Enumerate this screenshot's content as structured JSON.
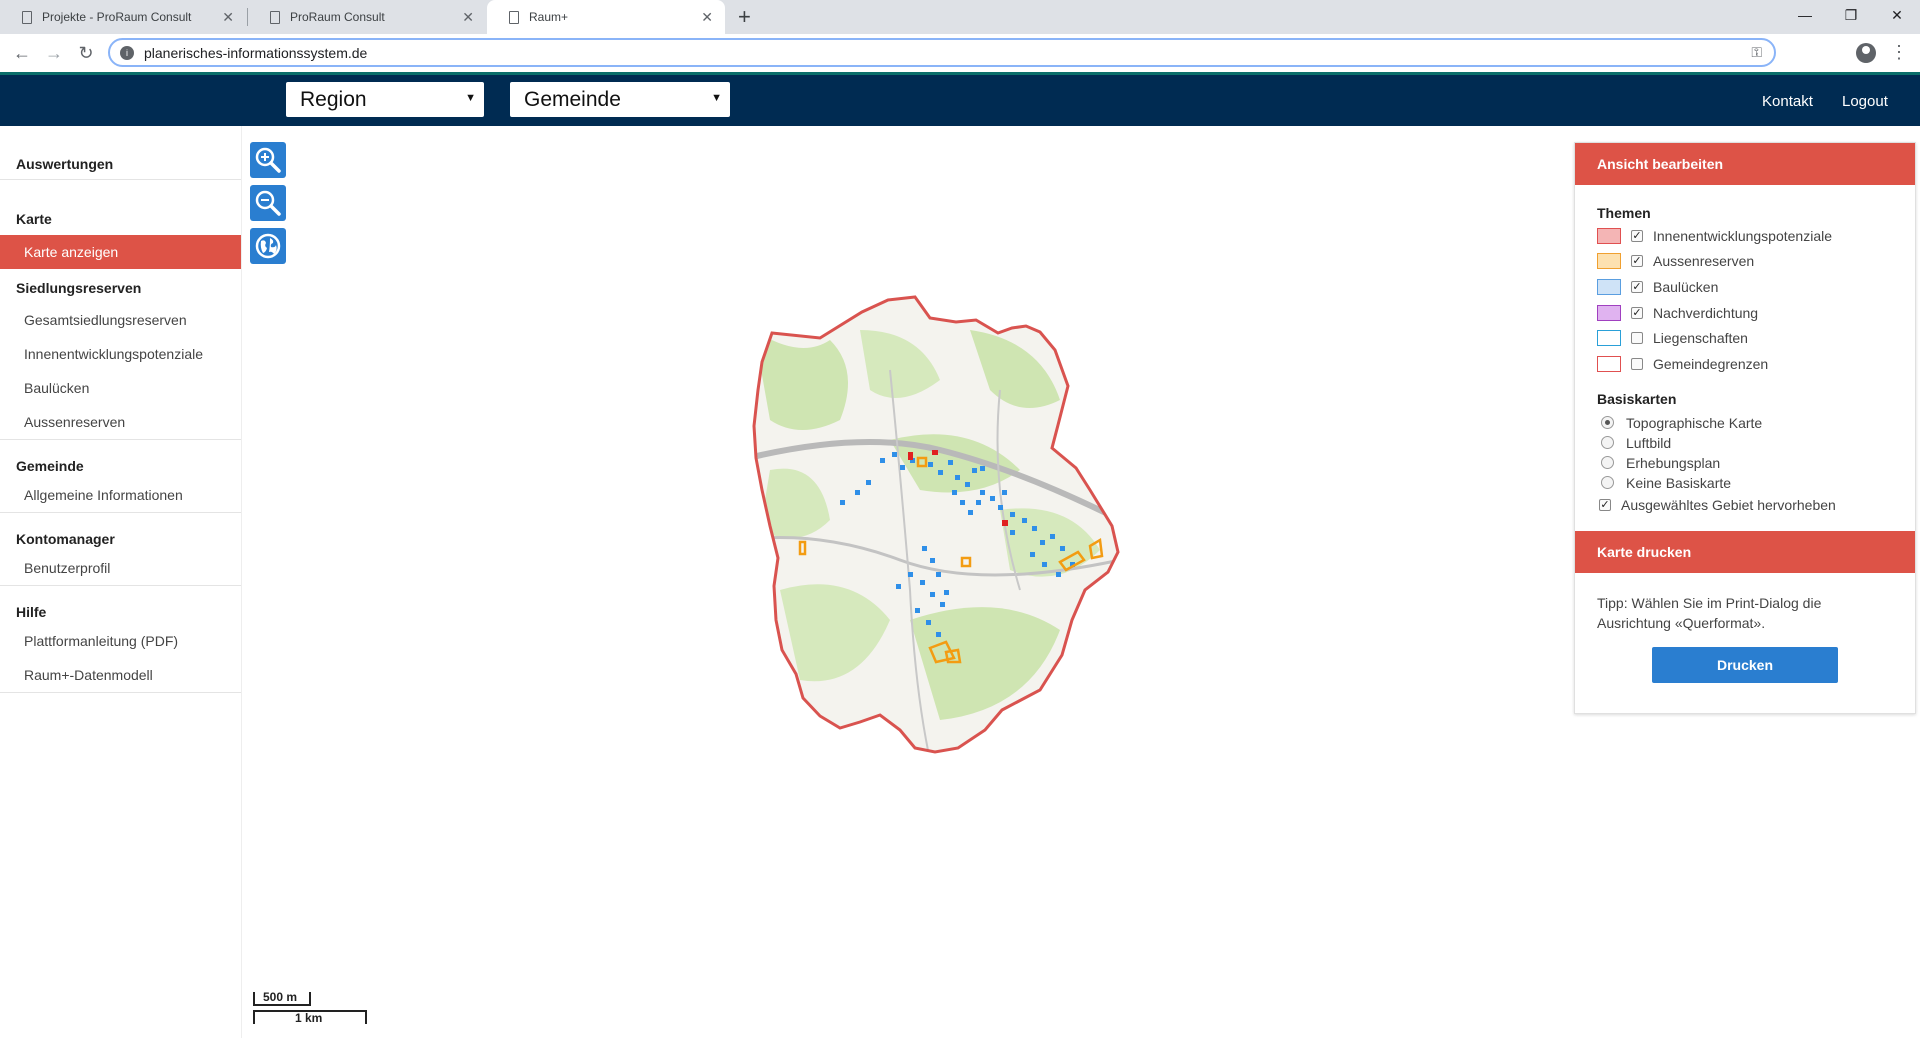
{
  "browser": {
    "tabs": [
      {
        "title": "Projekte - ProRaum Consult"
      },
      {
        "title": "ProRaum Consult"
      },
      {
        "title": "Raum+"
      }
    ],
    "url": "planerisches-informationssystem.de"
  },
  "header": {
    "region_select": "Region",
    "gemeinde_select": "Gemeinde",
    "kontakt": "Kontakt",
    "logout": "Logout"
  },
  "sidebar": {
    "auswertungen": "Auswertungen",
    "karte": "Karte",
    "karte_anzeigen": "Karte anzeigen",
    "siedlungsreserven": "Siedlungsreserven",
    "siedlung_items": [
      "Gesamtsiedlungsreserven",
      "Innenentwicklungspotenziale",
      "Baulücken",
      "Aussenreserven"
    ],
    "gemeinde": "Gemeinde",
    "gemeinde_items": [
      "Allgemeine Informationen"
    ],
    "kontomanager": "Kontomanager",
    "konto_items": [
      "Benutzerprofil"
    ],
    "hilfe": "Hilfe",
    "hilfe_items": [
      "Plattformanleitung (PDF)",
      "Raum+-Datenmodell"
    ]
  },
  "map": {
    "controls": [
      "zoom-in-icon",
      "zoom-out-icon",
      "globe-icon"
    ],
    "scale_small": "500 m",
    "scale_large": "1 km"
  },
  "panel": {
    "view_title": "Ansicht bearbeiten",
    "themen_label": "Themen",
    "themen": [
      {
        "label": "Innenentwicklungspotenziale",
        "checked": true,
        "color": "#f4b5b5",
        "border": "#e05050"
      },
      {
        "label": "Aussenreserven",
        "checked": true,
        "color": "#fde1b0",
        "border": "#f0a030"
      },
      {
        "label": "Baulücken",
        "checked": true,
        "color": "#cfe3f7",
        "border": "#5a9ee0"
      },
      {
        "label": "Nachverdichtung",
        "checked": true,
        "color": "#e0b3f0",
        "border": "#a040c0"
      },
      {
        "label": "Liegenschaften",
        "checked": false,
        "color": "#ffffff",
        "border": "#2aa0d8"
      },
      {
        "label": "Gemeindegrenzen",
        "checked": false,
        "color": "#ffffff",
        "border": "#e05050"
      }
    ],
    "basiskarten_label": "Basiskarten",
    "basiskarten": [
      {
        "label": "Topographische Karte",
        "selected": true
      },
      {
        "label": "Luftbild",
        "selected": false
      },
      {
        "label": "Erhebungsplan",
        "selected": false
      },
      {
        "label": "Keine Basiskarte",
        "selected": false
      }
    ],
    "highlight": {
      "label": "Ausgewähltes Gebiet hervorheben",
      "checked": true
    },
    "print_title": "Karte drucken",
    "tip": "Tipp: Wählen Sie im Print-Dialog die Ausrichtung «Querformat».",
    "print_button": "Drucken"
  },
  "colors": {
    "header": "#002b52",
    "accent_red": "#dd5347",
    "accent_blue": "#2a7ed0"
  }
}
